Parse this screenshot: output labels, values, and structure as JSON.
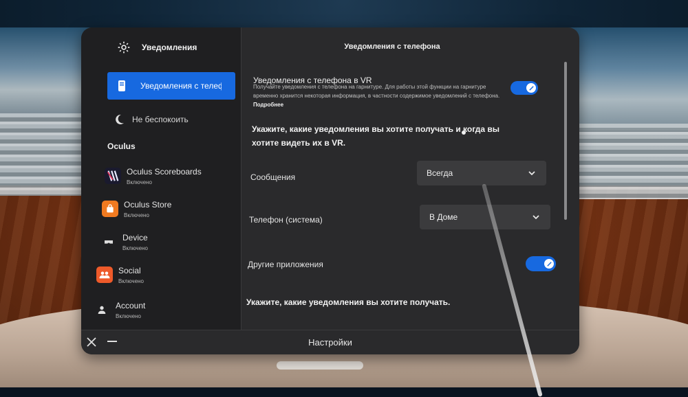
{
  "window_title": "Настройки",
  "sidebar": {
    "header": "Уведомления",
    "active_item": "Уведомления с телефона",
    "dnd_item": "Не беспокоить",
    "section": "Oculus",
    "apps": [
      {
        "name": "Oculus Scoreboards",
        "status": "Включено"
      },
      {
        "name": "Oculus Store",
        "status": "Включено"
      },
      {
        "name": "Device",
        "status": "Включено"
      },
      {
        "name": "Social",
        "status": "Включено"
      },
      {
        "name": "Account",
        "status": "Включено"
      }
    ]
  },
  "content": {
    "title": "Уведомления с телефона",
    "vr_toggle": {
      "label": "Уведомления с телефона в VR",
      "description": "Получайте уведомления с телефона на гарнитуре. Для работы этой функции на гарнитуре временно хранится некоторая информация, в частности содержимое уведомлений с телефона.",
      "more_link": "Подробнее",
      "enabled": true
    },
    "heading1": "Укажите, какие уведомления вы хотите получать и когда вы хотите видеть их в VR.",
    "messages": {
      "label": "Сообщения",
      "value": "Всегда"
    },
    "phone_system": {
      "label": "Телефон (система)",
      "value": "В Доме"
    },
    "other_apps": {
      "label": "Другие приложения",
      "enabled": true
    },
    "heading2": "Укажите, какие уведомления вы хотите получать."
  },
  "colors": {
    "accent": "#1769e0",
    "panel": "#2a2a2c",
    "sidebar": "#1f1f21"
  }
}
